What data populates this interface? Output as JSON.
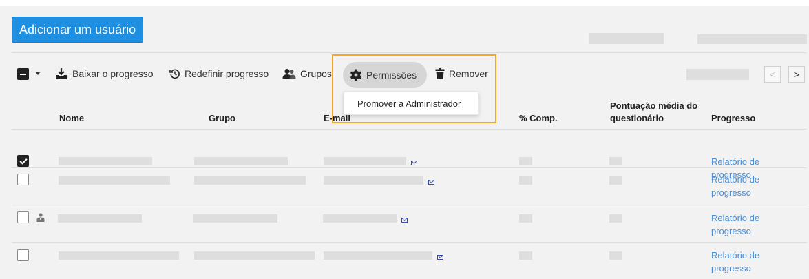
{
  "header": {
    "add_user_label": "Adicionar um usuário"
  },
  "toolbar": {
    "download_label": "Baixar o progresso",
    "reset_label": "Redefinir progresso",
    "groups_label": "Grupos",
    "permissions_label": "Permissões",
    "remove_label": "Remover"
  },
  "permissions_menu": {
    "items": [
      "Promover a Administrador"
    ]
  },
  "pager": {
    "prev": "<",
    "next": ">"
  },
  "table": {
    "columns": {
      "name": "Nome",
      "group": "Grupo",
      "email": "E-mail",
      "completion": "% Comp.",
      "quiz_line1": "Pontuação média do",
      "quiz_line2": "questionário",
      "progress": "Progresso"
    },
    "rows": [
      {
        "checked": true,
        "is_admin": false,
        "progress_link_line1": "Relatório de",
        "progress_link_line2": "progresso"
      },
      {
        "checked": false,
        "is_admin": false,
        "progress_link_line1": "Relatório de",
        "progress_link_line2": "progresso"
      },
      {
        "checked": false,
        "is_admin": true,
        "progress_link_line1": "Relatório de",
        "progress_link_line2": "progresso"
      },
      {
        "checked": false,
        "is_admin": false,
        "progress_link_line1": "Relatório de",
        "progress_link_line2": "progresso"
      }
    ]
  },
  "colors": {
    "accent": "#1e8fe1",
    "link": "#4a8fd6",
    "highlight": "#f5a623",
    "placeholder": "#dedede"
  },
  "icons": [
    "caret-down-icon",
    "download-icon",
    "reset-icon",
    "groups-icon",
    "gear-icon",
    "trash-icon",
    "mail-icon",
    "admin-icon"
  ]
}
